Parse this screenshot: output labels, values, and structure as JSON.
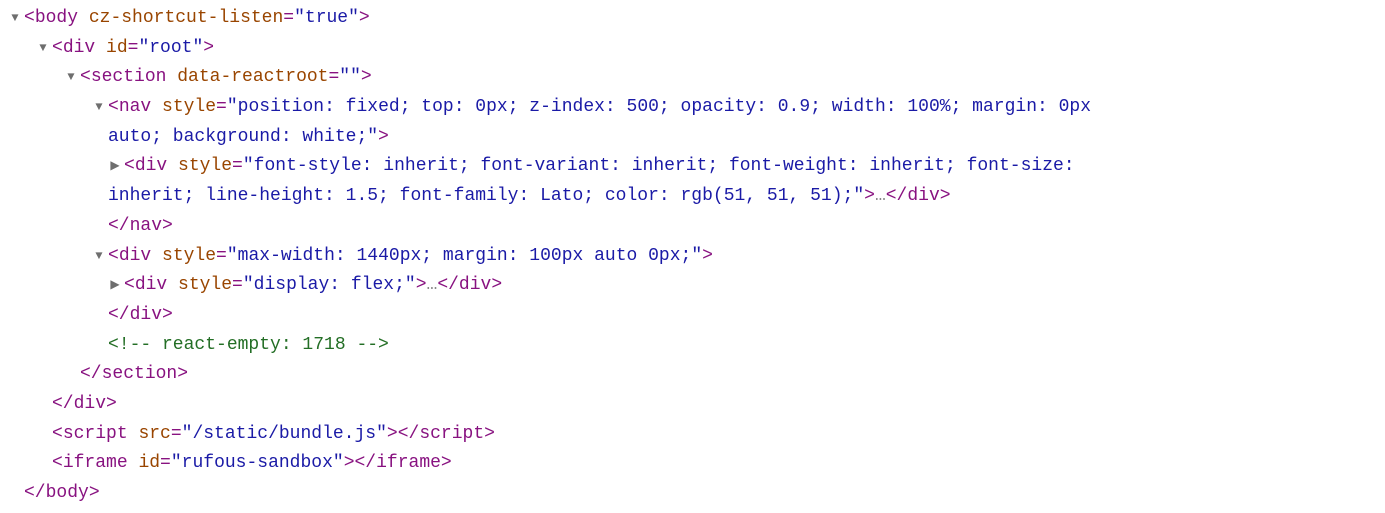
{
  "lines": {
    "l0_tag": "body",
    "l0_attr": "cz-shortcut-listen",
    "l0_val": "\"true\"",
    "l1_tag": "div",
    "l1_attr": "id",
    "l1_val": "\"root\"",
    "l2_tag": "section",
    "l2_attr": "data-reactroot",
    "l2_val": "\"\"",
    "l3_tag": "nav",
    "l3_attr": "style",
    "l3_val_a": "\"position: fixed; top: 0px; z-index: 500; opacity: 0.9; width: 100%; margin: 0px ",
    "l3_val_b": "auto; background: white;\"",
    "l4_tag": "div",
    "l4_attr": "style",
    "l4_val_a": "\"font-style: inherit; font-variant: inherit; font-weight: inherit; font-size: ",
    "l4_val_b": "inherit; line-height: 1.5; font-family: Lato; color: rgb(51, 51, 51);\"",
    "l4_ell": "…",
    "l4_close": "div",
    "l5_close": "nav",
    "l6_tag": "div",
    "l6_attr": "style",
    "l6_val": "\"max-width: 1440px; margin: 100px auto 0px;\"",
    "l7_tag": "div",
    "l7_attr": "style",
    "l7_val": "\"display: flex;\"",
    "l7_ell": "…",
    "l7_close": "div",
    "l8_close": "div",
    "l9_comment": "<!-- react-empty: 1718 -->",
    "l10_close": "section",
    "l11_close": "div",
    "l12_tag": "script",
    "l12_attr": "src",
    "l12_val": "\"/static/bundle.js\"",
    "l12_close": "script",
    "l13_tag": "iframe",
    "l13_attr": "id",
    "l13_val": "\"rufous-sandbox\"",
    "l13_close": "iframe",
    "l14_close": "body"
  }
}
